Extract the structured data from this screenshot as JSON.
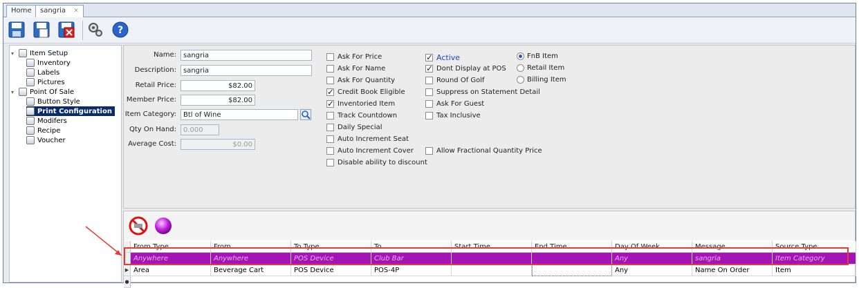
{
  "tabs": [
    {
      "label": "Home"
    },
    {
      "label": "sangria",
      "close": "✕"
    }
  ],
  "toolbar": {
    "icons": [
      "save-icon",
      "save-new-icon",
      "delete-icon",
      "settings-icon",
      "help-icon"
    ]
  },
  "tree": [
    {
      "label": "Item Setup",
      "level": 0,
      "expanded": true
    },
    {
      "label": "Inventory",
      "level": 1
    },
    {
      "label": "Labels",
      "level": 1
    },
    {
      "label": "Pictures",
      "level": 1
    },
    {
      "label": "Point Of Sale",
      "level": 0,
      "expanded": true
    },
    {
      "label": "Button Style",
      "level": 1
    },
    {
      "label": "Print Configuration",
      "level": 1,
      "selected": true
    },
    {
      "label": "Modifers",
      "level": 1
    },
    {
      "label": "Recipe",
      "level": 1
    },
    {
      "label": "Voucher",
      "level": 1
    }
  ],
  "form": {
    "name_label": "Name:",
    "name_value": "sangria",
    "description_label": "Description:",
    "description_value": "sangria",
    "retail_price_label": "Retail Price:",
    "retail_price_value": "$82.00",
    "member_price_label": "Member Price:",
    "member_price_value": "$82.00",
    "item_category_label": "Item Category:",
    "item_category_value": "Btl of Wine",
    "qty_on_hand_label": "Qty On Hand:",
    "qty_on_hand_value": "0.000",
    "average_cost_label": "Average Cost:",
    "average_cost_value": "$0.00"
  },
  "checks_col1": [
    {
      "label": "Ask For Price",
      "checked": false
    },
    {
      "label": "Ask For Name",
      "checked": false
    },
    {
      "label": "Ask For Quantity",
      "checked": false
    },
    {
      "label": "Credit Book Eligible",
      "checked": true
    },
    {
      "label": "Inventoried Item",
      "checked": true
    },
    {
      "label": "Track Countdown",
      "checked": false
    },
    {
      "label": "Daily Special",
      "checked": false
    },
    {
      "label": "Auto Increment Seat",
      "checked": false
    },
    {
      "label": "Auto Increment Cover",
      "checked": false
    },
    {
      "label": "Disable ability to discount",
      "checked": false
    }
  ],
  "checks_col2": [
    {
      "label": "Active",
      "checked": true
    },
    {
      "label": "Dont Display at POS",
      "checked": true
    },
    {
      "label": "Round Of Golf",
      "checked": false
    },
    {
      "label": "Suppress on Statement Detail",
      "checked": false
    },
    {
      "label": "Ask For Guest",
      "checked": false
    },
    {
      "label": "Tax Inclusive",
      "checked": false
    }
  ],
  "fractional": {
    "label": "Allow Fractional Quantity  Price",
    "checked": false
  },
  "radios": [
    {
      "label": "FnB Item",
      "selected": true
    },
    {
      "label": "Retail Item",
      "selected": false
    },
    {
      "label": "Billing Item",
      "selected": false
    }
  ],
  "grid": {
    "columns": [
      "From Type",
      "From",
      "To Type",
      "To",
      "Start Time",
      "End Time",
      "Day Of Week",
      "Message",
      "Source Type"
    ],
    "rows": [
      [
        "Anywhere",
        "Anywhere",
        "POS Device",
        "Club Bar",
        "",
        "",
        "Any",
        "sangria",
        "Item Category"
      ],
      [
        "Area",
        "Beverage Cart",
        "POS Device",
        "POS-4P",
        "",
        "",
        "Any",
        "Name On Order",
        "Item"
      ]
    ],
    "divider_grip": "....."
  },
  "colors": {
    "highlight_row": "#a413b5",
    "annotation": "#e23a3a",
    "selected_tree": "#0a2a6b"
  }
}
